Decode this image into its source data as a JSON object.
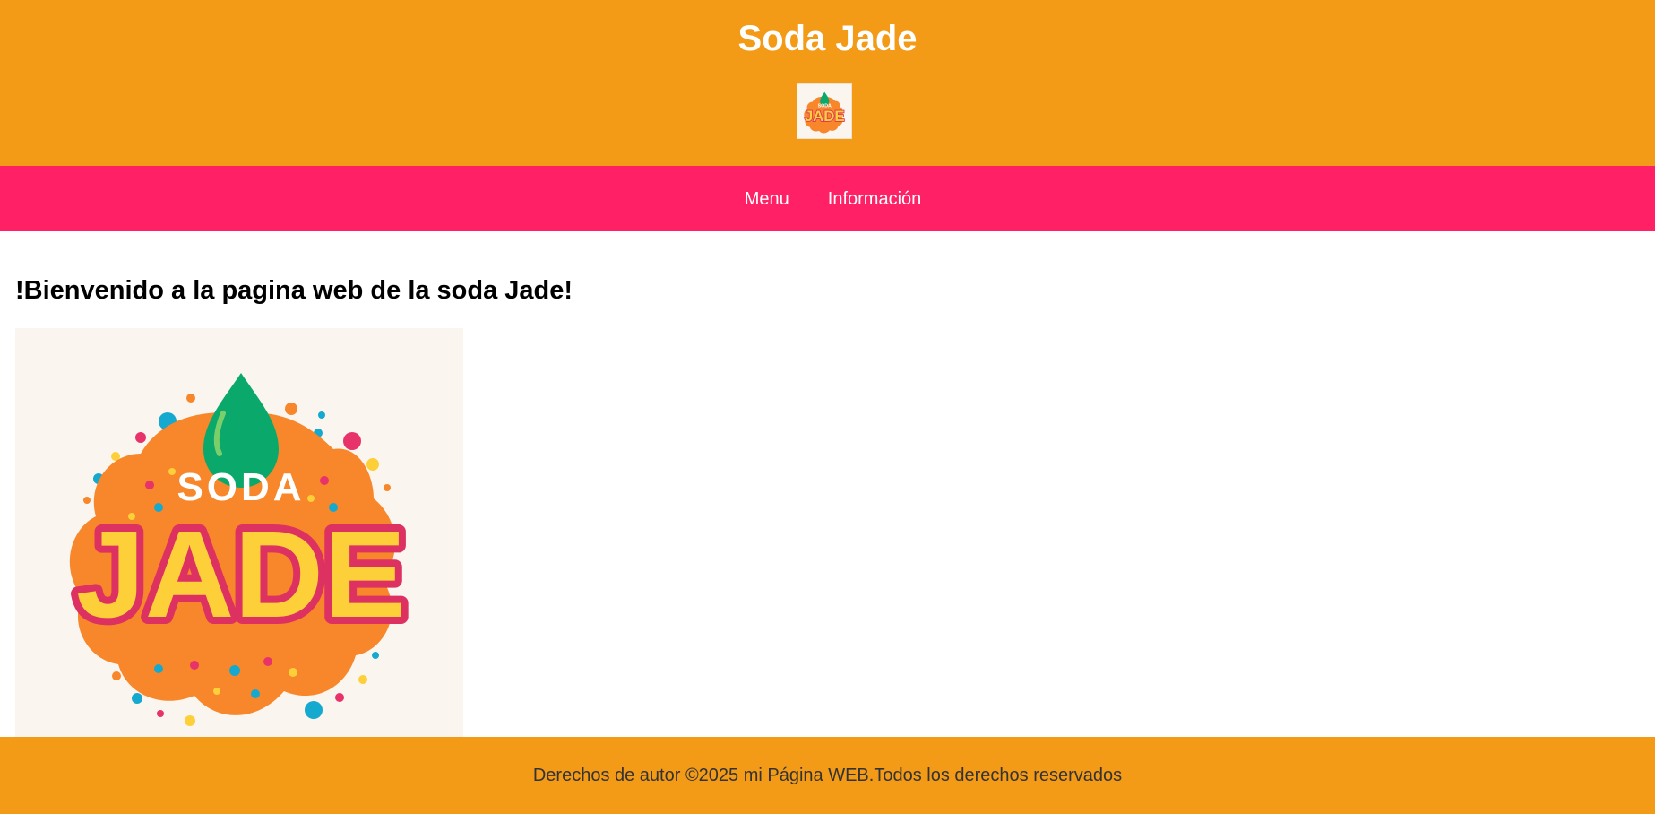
{
  "header": {
    "title": "Soda Jade",
    "logo_icon": "soda-jade-logo",
    "logo_text_top": "SODA",
    "logo_text_bottom": "JADE"
  },
  "nav": {
    "items": [
      {
        "label": "Menu"
      },
      {
        "label": "Información"
      }
    ]
  },
  "main": {
    "heading": "!Bienvenido a la pagina web de la soda Jade!",
    "image_icon": "soda-jade-logo",
    "image_text_top": "SODA",
    "image_text_bottom": "JADE"
  },
  "footer": {
    "text": "Derechos de autor ©2025 mi Página WEB.Todos los derechos reservados"
  },
  "colors": {
    "header_bg": "#f39a17",
    "nav_bg": "#ff2066",
    "footer_bg": "#f39a17",
    "logo_splash": "#f7872a",
    "logo_drop": "#0aa86b",
    "logo_outline": "#dd3161",
    "logo_letters": "#fdd03a"
  }
}
